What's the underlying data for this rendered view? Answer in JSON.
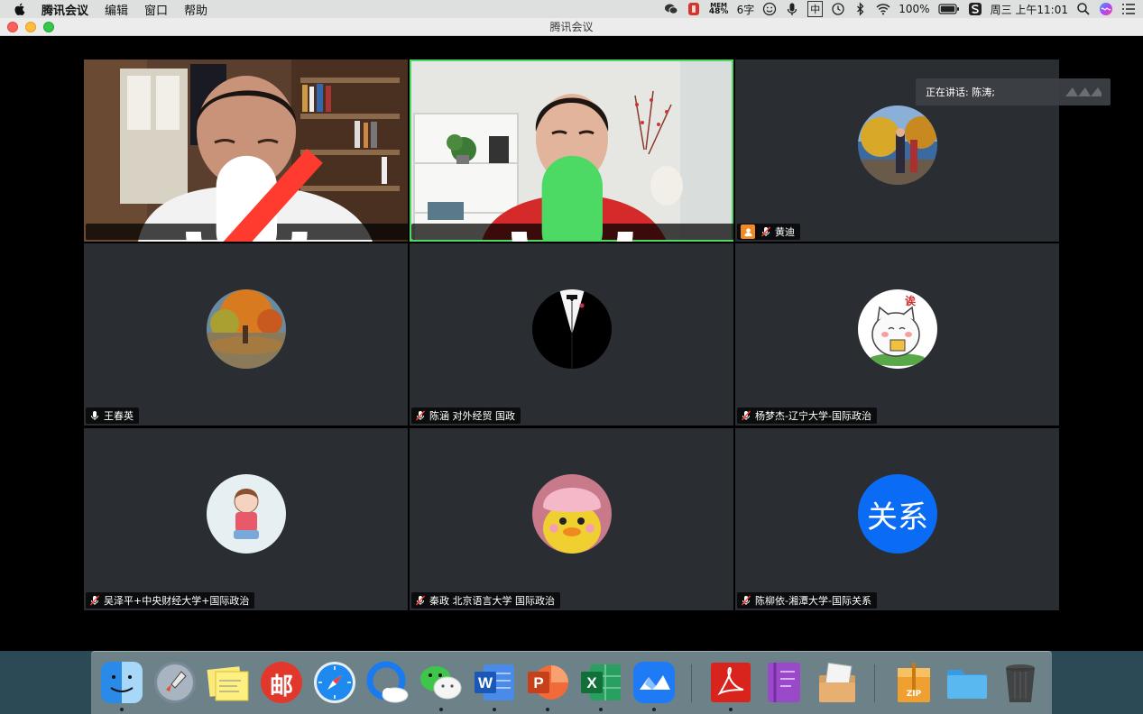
{
  "menubar": {
    "items": [
      "腾讯会议",
      "编辑",
      "窗口",
      "帮助"
    ],
    "mem_label": "MEM",
    "mem_value": "48%",
    "input_text": "6字",
    "ime": "中",
    "battery": "100%",
    "clock": "周三 上午11:01"
  },
  "window": {
    "title": "腾讯会议",
    "speaking_label": "正在讲话: 陈涛;"
  },
  "participants": [
    {
      "name": "杨晖"
    },
    {
      "name": "陈涛"
    },
    {
      "name": "黄迪"
    },
    {
      "name": "王春英"
    },
    {
      "name": "陈涵 对外经贸 国政"
    },
    {
      "name": "杨梦杰-辽宁大学-国际政治"
    },
    {
      "name": "吴泽平+中央财经大学+国际政治"
    },
    {
      "name": "秦政 北京语言大学 国际政治"
    },
    {
      "name": "陈柳依-湘潭大学-国际关系"
    }
  ],
  "avatar_text": {
    "guanxi": "关系",
    "sticker": "诶"
  },
  "dock": {
    "zip_label": "ZIP",
    "word_letter": "W",
    "ppt_letter": "P",
    "excel_letter": "X",
    "mail_char": "邮"
  }
}
